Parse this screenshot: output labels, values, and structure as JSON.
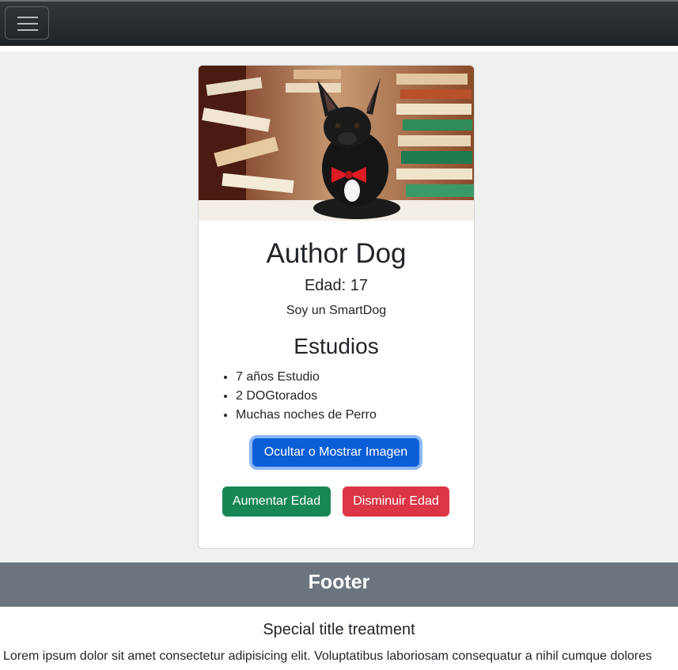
{
  "navbar": {
    "toggler_icon": "hamburger-menu-icon"
  },
  "card": {
    "image_alt": "dog-with-books-photo",
    "title": "Author Dog",
    "age_label": "Edad: 17",
    "description": "Soy un SmartDog",
    "studies_title": "Estudios",
    "studies": [
      "7 años Estudio",
      "2 DOGtorados",
      "Muchas noches de Perro"
    ],
    "toggle_image_button": "Ocultar o Mostrar Imagen",
    "increase_age_button": "Aumentar Edad",
    "decrease_age_button": "Disminuir Edad"
  },
  "footer": {
    "header": "Footer",
    "title": "Special title treatment",
    "text": "Lorem ipsum dolor sit amet consectetur adipisicing elit. Voluptatibus laboriosam consequatur a nihil cumque dolores"
  },
  "colors": {
    "primary": "#0b5ed7",
    "success": "#198754",
    "danger": "#dc3545",
    "footer_header": "#6c757d",
    "navbar": "#212529"
  }
}
